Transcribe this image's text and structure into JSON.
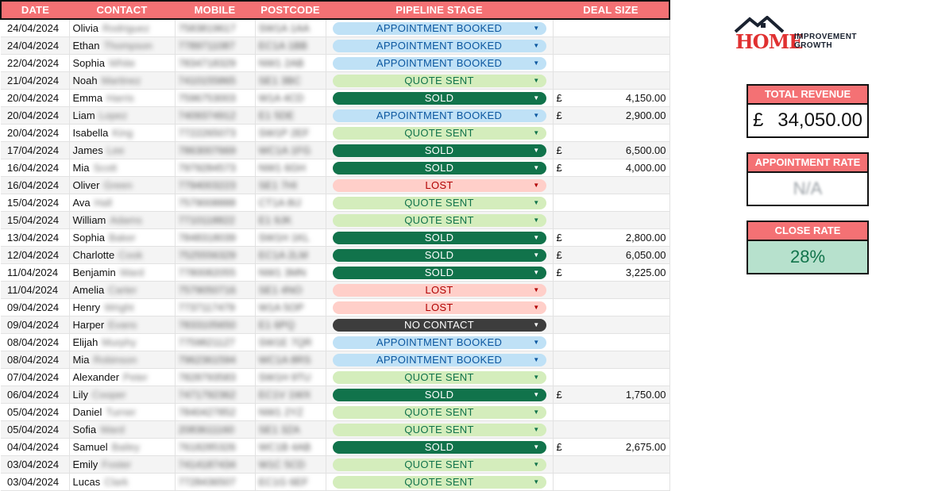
{
  "columns": [
    "DATE",
    "CONTACT",
    "MOBILE",
    "POSTCODE",
    "PIPELINE STAGE",
    "DEAL SIZE"
  ],
  "currency": "£",
  "rows": [
    {
      "date": "24/04/2024",
      "first": "Olivia",
      "last": "Rodriguez",
      "mobile": "7583819617",
      "postcode": "SW1A 1AA",
      "stage": "APPOINTMENT BOOKED",
      "deal": ""
    },
    {
      "date": "24/04/2024",
      "first": "Ethan",
      "last": "Thompson",
      "mobile": "7789711087",
      "postcode": "EC1A 1BB",
      "stage": "APPOINTMENT BOOKED",
      "deal": ""
    },
    {
      "date": "22/04/2024",
      "first": "Sophia",
      "last": "White",
      "mobile": "7834718329",
      "postcode": "NW1 2AB",
      "stage": "APPOINTMENT BOOKED",
      "deal": ""
    },
    {
      "date": "21/04/2024",
      "first": "Noah",
      "last": "Martinez",
      "mobile": "7410155865",
      "postcode": "SE1 3BC",
      "stage": "QUOTE SENT",
      "deal": ""
    },
    {
      "date": "20/04/2024",
      "first": "Emma",
      "last": "Harris",
      "mobile": "7596753003",
      "postcode": "W1A 4CD",
      "stage": "SOLD",
      "deal": "4,150.00"
    },
    {
      "date": "20/04/2024",
      "first": "Liam",
      "last": "Lopez",
      "mobile": "7409374912",
      "postcode": "E1 5DE",
      "stage": "APPOINTMENT BOOKED",
      "deal": "2,900.00"
    },
    {
      "date": "20/04/2024",
      "first": "Isabella",
      "last": "King",
      "mobile": "7722265073",
      "postcode": "SW1P 2EF",
      "stage": "QUOTE SENT",
      "deal": ""
    },
    {
      "date": "17/04/2024",
      "first": "James",
      "last": "Lee",
      "mobile": "7863007669",
      "postcode": "WC1A 1FG",
      "stage": "SOLD",
      "deal": "6,500.00"
    },
    {
      "date": "16/04/2024",
      "first": "Mia",
      "last": "Scott",
      "mobile": "7979284573",
      "postcode": "NW1 6GH",
      "stage": "SOLD",
      "deal": "4,000.00"
    },
    {
      "date": "16/04/2024",
      "first": "Oliver",
      "last": "Green",
      "mobile": "7794003223",
      "postcode": "SE1 7HI",
      "stage": "LOST",
      "deal": ""
    },
    {
      "date": "15/04/2024",
      "first": "Ava",
      "last": "Hall",
      "mobile": "7579008888",
      "postcode": "CT1A 8IJ",
      "stage": "QUOTE SENT",
      "deal": ""
    },
    {
      "date": "15/04/2024",
      "first": "William",
      "last": "Adams",
      "mobile": "7710118822",
      "postcode": "E1 9JK",
      "stage": "QUOTE SENT",
      "deal": ""
    },
    {
      "date": "13/04/2024",
      "first": "Sophia",
      "last": "Baker",
      "mobile": "7848318039",
      "postcode": "SW1H 1KL",
      "stage": "SOLD",
      "deal": "2,800.00"
    },
    {
      "date": "12/04/2024",
      "first": "Charlotte",
      "last": "Cook",
      "mobile": "7525556329",
      "postcode": "EC1A 2LM",
      "stage": "SOLD",
      "deal": "6,050.00"
    },
    {
      "date": "11/04/2024",
      "first": "Benjamin",
      "last": "Ward",
      "mobile": "7780082055",
      "postcode": "NW1 3MN",
      "stage": "SOLD",
      "deal": "3,225.00"
    },
    {
      "date": "11/04/2024",
      "first": "Amelia",
      "last": "Carter",
      "mobile": "7579050716",
      "postcode": "SE1 4NO",
      "stage": "LOST",
      "deal": ""
    },
    {
      "date": "09/04/2024",
      "first": "Henry",
      "last": "Wright",
      "mobile": "7737117479",
      "postcode": "W1A 5OP",
      "stage": "LOST",
      "deal": ""
    },
    {
      "date": "09/04/2024",
      "first": "Harper",
      "last": "Evans",
      "mobile": "7833105650",
      "postcode": "E1 6PQ",
      "stage": "NO CONTACT",
      "deal": ""
    },
    {
      "date": "08/04/2024",
      "first": "Elijah",
      "last": "Murphy",
      "mobile": "7759821127",
      "postcode": "SW1E 7QR",
      "stage": "APPOINTMENT BOOKED",
      "deal": ""
    },
    {
      "date": "08/04/2024",
      "first": "Mia",
      "last": "Robinson",
      "mobile": "7962361594",
      "postcode": "WC1A 8RS",
      "stage": "APPOINTMENT BOOKED",
      "deal": ""
    },
    {
      "date": "07/04/2024",
      "first": "Alexander",
      "last": "Peter",
      "mobile": "7828793583",
      "postcode": "SW1H 9TU",
      "stage": "QUOTE SENT",
      "deal": ""
    },
    {
      "date": "06/04/2024",
      "first": "Lily",
      "last": "Cooper",
      "mobile": "7471792362",
      "postcode": "EC1V 1WX",
      "stage": "SOLD",
      "deal": "1,750.00"
    },
    {
      "date": "05/04/2024",
      "first": "Daniel",
      "last": "Turner",
      "mobile": "7840427852",
      "postcode": "NW1 2YZ",
      "stage": "QUOTE SENT",
      "deal": ""
    },
    {
      "date": "05/04/2024",
      "first": "Sofia",
      "last": "Ward",
      "mobile": "2083611160",
      "postcode": "SE1 3ZA",
      "stage": "QUOTE SENT",
      "deal": ""
    },
    {
      "date": "04/04/2024",
      "first": "Samuel",
      "last": "Bailey",
      "mobile": "7618285326",
      "postcode": "WC1B 4AB",
      "stage": "SOLD",
      "deal": "2,675.00"
    },
    {
      "date": "03/04/2024",
      "first": "Emily",
      "last": "Foster",
      "mobile": "7414187434",
      "postcode": "W1C 5CD",
      "stage": "QUOTE SENT",
      "deal": ""
    },
    {
      "date": "03/04/2024",
      "first": "Lucas",
      "last": "Clark",
      "mobile": "7728436507",
      "postcode": "EC1G 6EF",
      "stage": "QUOTE SENT",
      "deal": ""
    }
  ],
  "stage_colors": {
    "APPOINTMENT BOOKED": "#bfe1f6",
    "QUOTE SENT": "#d4edbc",
    "SOLD": "#11734b",
    "LOST": "#ffcfc9",
    "NO CONTACT": "#3d3d3d"
  },
  "logo": {
    "home": "HOME",
    "line1": "IMPROVEMENT",
    "line2": "GROWTH",
    "icon": "house-roof-icon"
  },
  "metrics": {
    "total_revenue": {
      "title": "TOTAL REVENUE",
      "currency": "£",
      "value": "34,050.00"
    },
    "appointment_rate": {
      "title": "APPOINTMENT RATE",
      "value": "N/A"
    },
    "close_rate": {
      "title": "CLOSE RATE",
      "value": "28%"
    }
  },
  "colors": {
    "header": "#f47174",
    "close_rate_bg": "#b7e1cd"
  }
}
